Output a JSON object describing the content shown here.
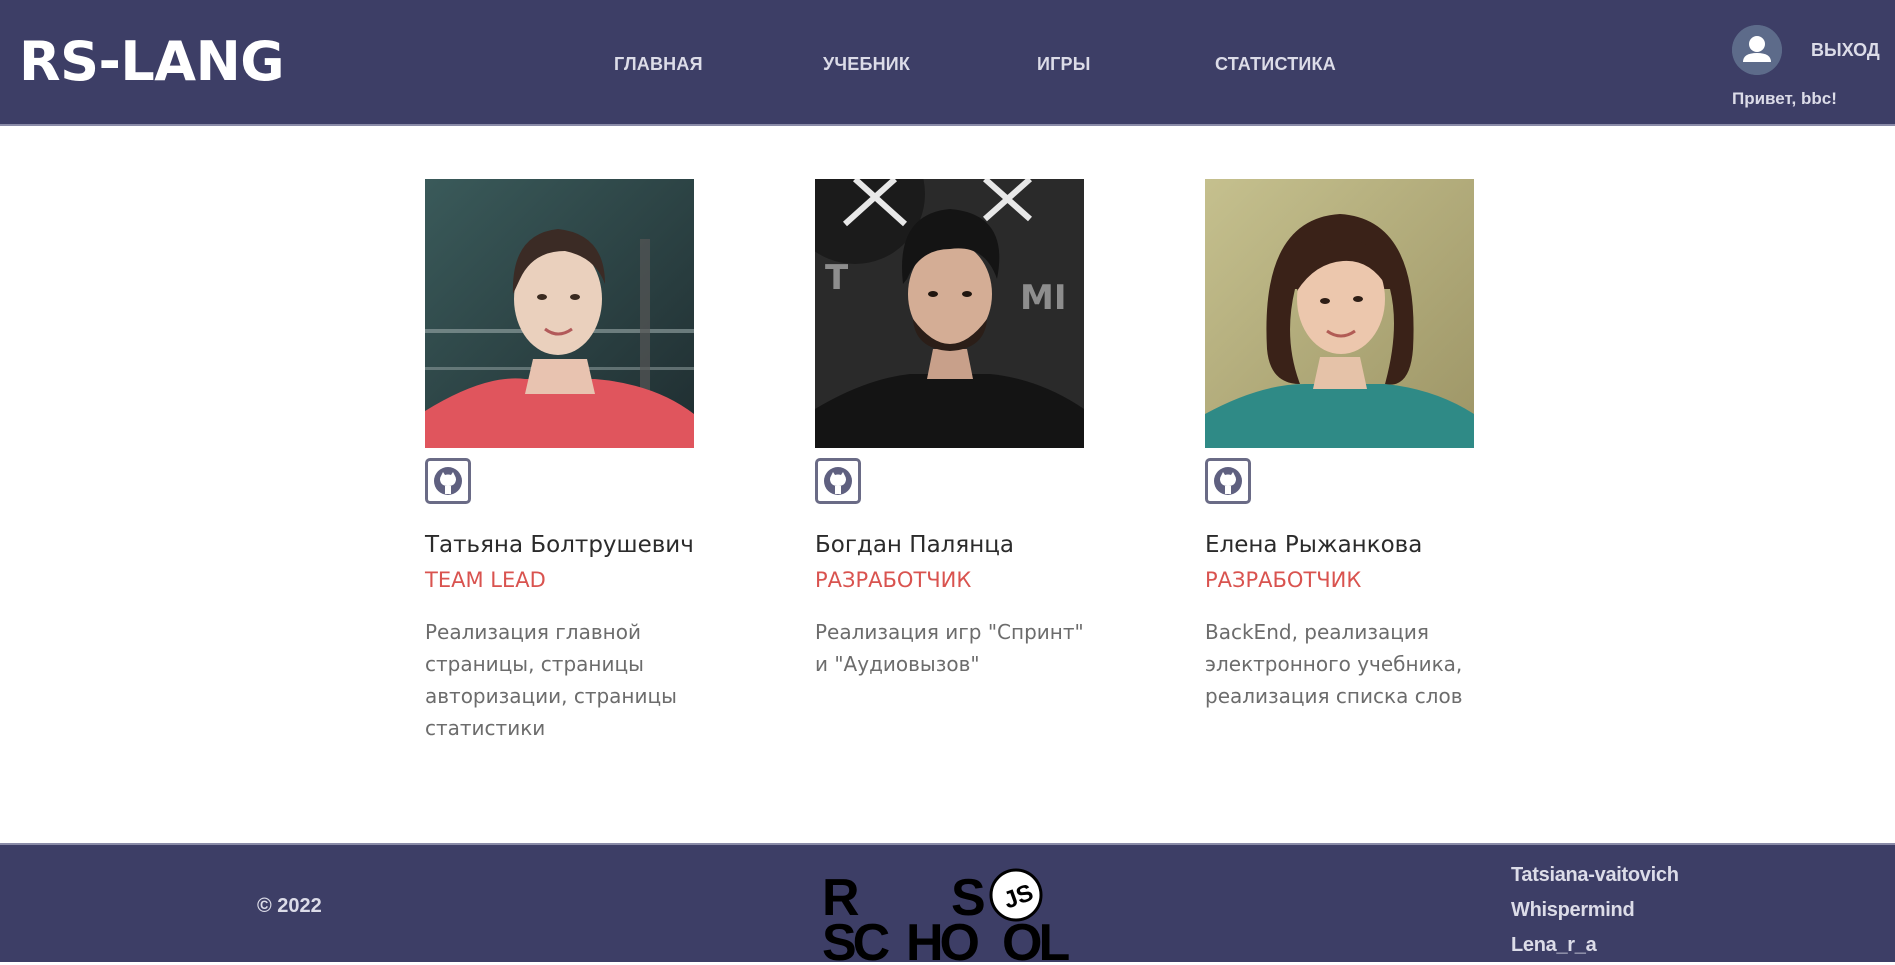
{
  "header": {
    "logo": "RS-LANG",
    "nav": [
      {
        "label": "ГЛАВНАЯ"
      },
      {
        "label": "УЧЕБНИК"
      },
      {
        "label": "ИГРЫ"
      },
      {
        "label": "СТАТИСТИКА"
      }
    ],
    "logout_label": "ВЫХОД",
    "greeting": "Привет, bbc!"
  },
  "team": [
    {
      "name": "Татьяна Болтрушевич",
      "role": "TEAM LEAD",
      "description": "Реализация главной страницы, страницы авторизации, страницы статистики",
      "photo_icon": "photo-woman-red-dress"
    },
    {
      "name": "Богдан Палянца",
      "role": "РАЗРАБОТЧИК",
      "description": "Реализация игр \"Спринт\" и \"Аудиовызов\"",
      "photo_icon": "photo-man-black-shirt"
    },
    {
      "name": "Елена Рыжанкова",
      "role": "РАЗРАБОТЧИК",
      "description": "BackEnd, реализация электронного учебника, реализация списка слов",
      "photo_icon": "photo-woman-teal-top"
    }
  ],
  "footer": {
    "copyright": "© 2022",
    "rs_logo": {
      "line1": "R    S",
      "line2": "SC HO OL",
      "badge": "JS"
    },
    "github_links": [
      "Tatsiana-vaitovich",
      "Whispermind",
      "Lena_r_a"
    ]
  },
  "colors": {
    "header_bg": "#3d3e66",
    "accent_role": "#d9534f",
    "nav_text": "#dcdce8"
  }
}
